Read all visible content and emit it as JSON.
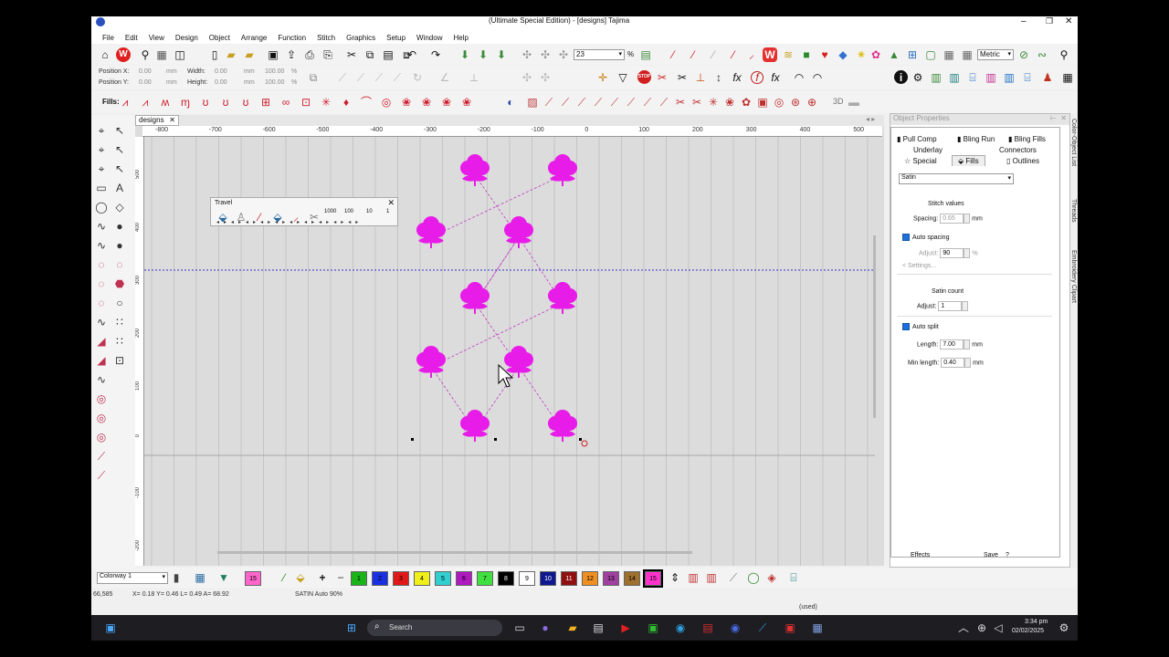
{
  "title": "(Ultimate Special Edition) - [designs] Tajima",
  "menu": [
    "File",
    "Edit",
    "View",
    "Design",
    "Object",
    "Arrange",
    "Function",
    "Stitch",
    "Graphics",
    "Setup",
    "Window",
    "Help"
  ],
  "toolbar": {
    "zoom_value": "23",
    "zoom_unit": "%",
    "units": "Metric"
  },
  "position": {
    "x_label": "Position X:",
    "y_label": "Position Y:",
    "x_val": "0.00",
    "y_val": "0.00",
    "x_unit": "mm",
    "y_unit": "mm",
    "w_label": "Width:",
    "h_label": "Height:",
    "w_val": "0.00",
    "h_val": "0.00",
    "w_unit": "mm",
    "h_unit": "mm",
    "wp": "100.00",
    "hp": "100.00",
    "pct": "%"
  },
  "fills_label": "Fills:",
  "fills_extra": "3D",
  "tab": "designs",
  "ruler": {
    "h": [
      "-800",
      "-700",
      "-600",
      "-500",
      "-400",
      "-300",
      "-200",
      "-100",
      "0",
      "100",
      "200",
      "300",
      "400",
      "500"
    ],
    "v": [
      "500",
      "400",
      "300",
      "200",
      "100",
      "0",
      "-100",
      "-200"
    ]
  },
  "travel": {
    "title": "Travel",
    "values": [
      "1000",
      "100",
      "10",
      "1"
    ]
  },
  "props": {
    "title": "Object Properties",
    "tabs_row1": [
      "Pull Comp",
      "Bling Run",
      "Bling Fills"
    ],
    "tabs_row2": [
      "Underlay",
      "Connectors"
    ],
    "tabs_row3": [
      "Special",
      "Fills",
      "Outlines"
    ],
    "fill_type": "Satin",
    "stitch_values": "Stitch values",
    "spacing_label": "Spacing:",
    "spacing_val": "0.65",
    "spacing_unit": "mm",
    "auto_spacing": "Auto spacing",
    "adjust_label": "Adjust:",
    "adjust_val": "90",
    "adjust_unit": "%",
    "settings": "Settings...",
    "satin_count": "Satin count",
    "adjust2_label": "Adjust:",
    "adjust2_val": "1",
    "auto_split": "Auto split",
    "length_label": "Length:",
    "length_val": "7.00",
    "length_unit": "mm",
    "minlen_label": "Min length:",
    "minlen_val": "0.40",
    "minlen_unit": "mm",
    "effects": "Effects",
    "save": "Save",
    "help": "?"
  },
  "sidetabs": [
    "Color-Object List",
    "Threads",
    "Embroidery Clipart"
  ],
  "colorway": "Colorway 1",
  "swatches": [
    {
      "n": "15",
      "c": "#ff66cc"
    },
    {
      "n": "1",
      "c": "#18b418"
    },
    {
      "n": "2",
      "c": "#1830e0"
    },
    {
      "n": "3",
      "c": "#e01818"
    },
    {
      "n": "4",
      "c": "#f0f018"
    },
    {
      "n": "5",
      "c": "#30d0d0"
    },
    {
      "n": "6",
      "c": "#b018c0"
    },
    {
      "n": "7",
      "c": "#40e040"
    },
    {
      "n": "8",
      "c": "#000000"
    },
    {
      "n": "9",
      "c": "#ffffff"
    },
    {
      "n": "10",
      "c": "#101890"
    },
    {
      "n": "11",
      "c": "#901010"
    },
    {
      "n": "12",
      "c": "#f09020"
    },
    {
      "n": "13",
      "c": "#a040a0"
    },
    {
      "n": "14",
      "c": "#a07030"
    },
    {
      "n": "15",
      "c": "#ff33cc"
    }
  ],
  "status": {
    "coords": "66,585",
    "xyl": "X=  0.18 Y=  0.46 L=  0.49 A=  68.92",
    "stitch": "SATIN Auto 90%",
    "used": "(used)"
  },
  "taskbar": {
    "search": "Search",
    "time": "3:34 pm",
    "date": "02/02/2025"
  },
  "colors": {
    "flower": "#e81ce8",
    "guide": "#3333cc"
  }
}
